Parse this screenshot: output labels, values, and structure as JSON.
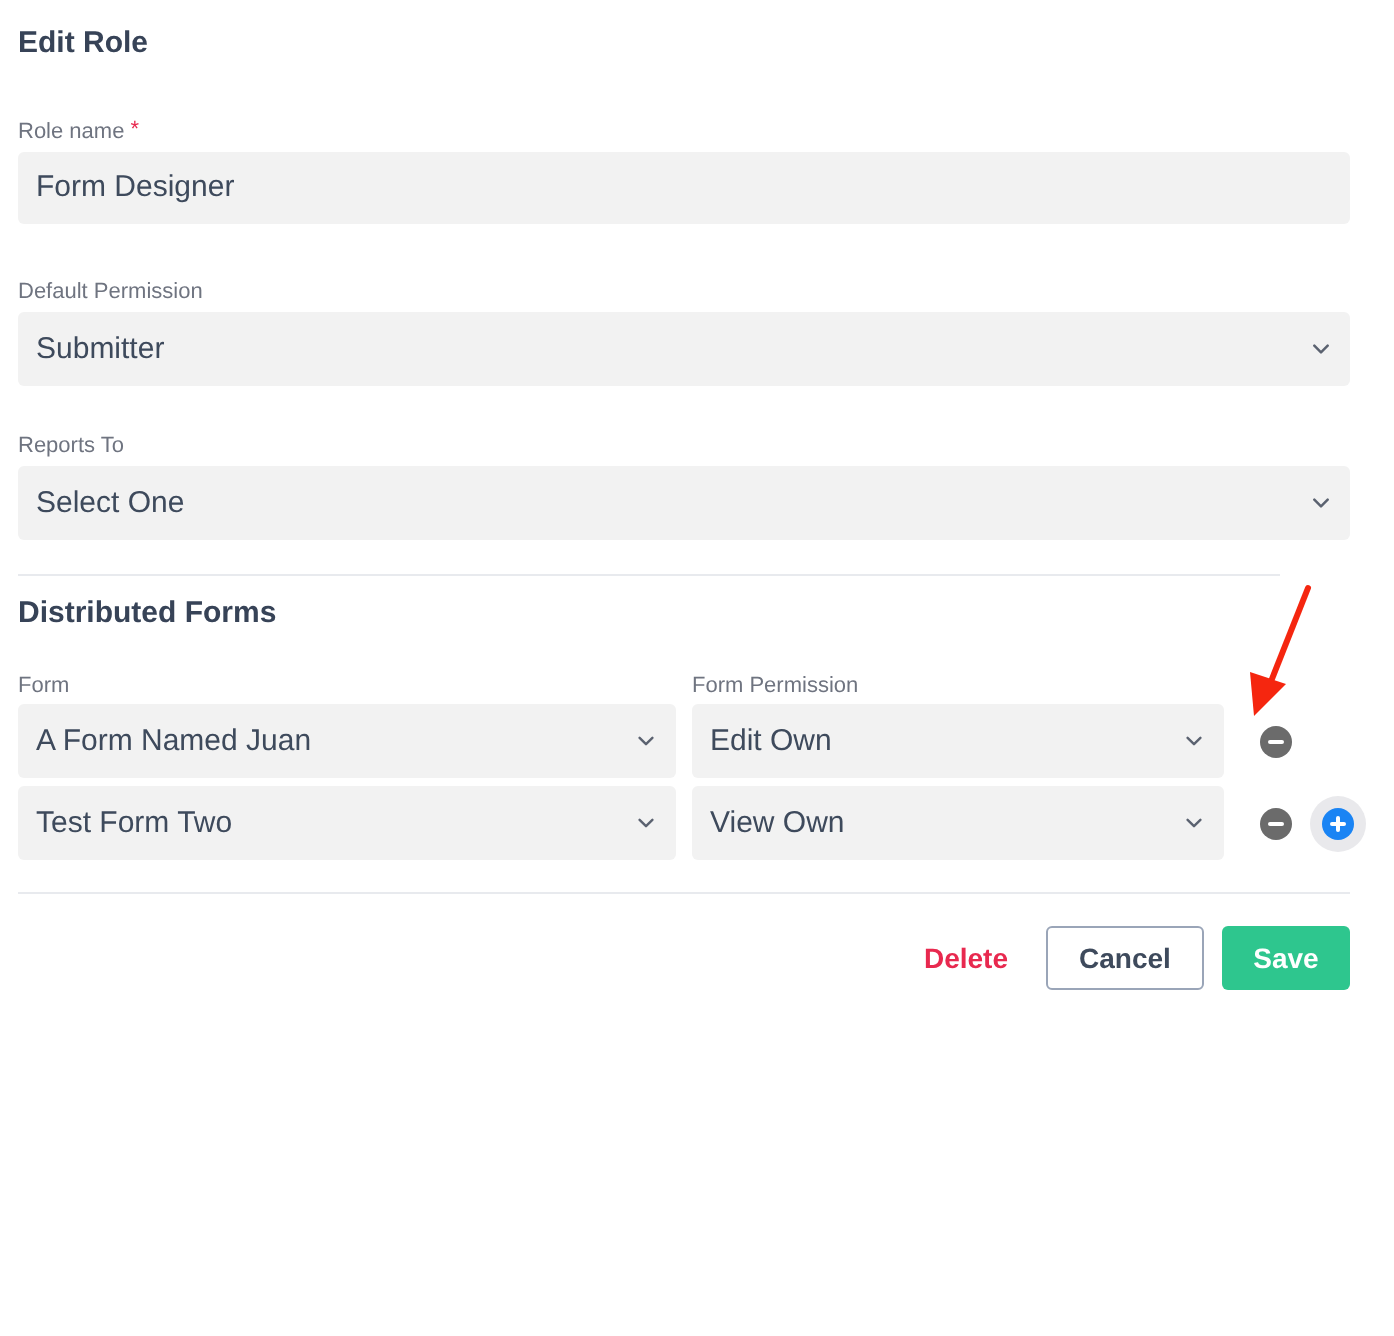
{
  "title": "Edit Role",
  "fields": [
    {
      "kind": "text",
      "label": "Role name",
      "required_mark": "*",
      "value": "Form Designer"
    },
    {
      "kind": "select",
      "label": "Default Permission",
      "value": "Submitter"
    },
    {
      "kind": "select",
      "label": "Reports To",
      "value": "Select One"
    }
  ],
  "distributed_forms": {
    "heading": "Distributed Forms",
    "columns": [
      "Form",
      "Form Permission"
    ],
    "rows": [
      {
        "form": "A Form Named Juan",
        "permission": "Edit Own",
        "can_add": false
      },
      {
        "form": "Test Form Two",
        "permission": "View Own",
        "can_add": true
      }
    ]
  },
  "actions": [
    {
      "kind": "danger",
      "label": "Delete"
    },
    {
      "kind": "secondary",
      "label": "Cancel"
    },
    {
      "kind": "primary",
      "label": "Save"
    }
  ]
}
